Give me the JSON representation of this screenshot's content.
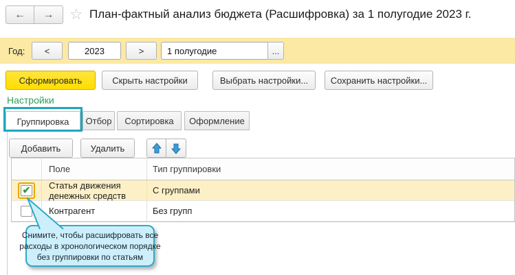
{
  "window": {
    "title": "План-фактный анализ бюджета (Расшифровка) за 1 полугодие 2023 г."
  },
  "icons": {
    "back": "←",
    "forward": "→",
    "favorite": "☆",
    "more": "...",
    "check": "✔",
    "move_up": "up-arrow",
    "move_down": "down-arrow"
  },
  "period_bar": {
    "year_label": "Год:",
    "prev": "<",
    "year": "2023",
    "next": ">",
    "period_value": "1 полугодие"
  },
  "actions": {
    "generate": "Сформировать",
    "hide_settings": "Скрыть настройки",
    "choose_settings": "Выбрать настройки...",
    "save_settings": "Сохранить настройки..."
  },
  "settings": {
    "header": "Настройки",
    "tabs": [
      {
        "label": "Группировка",
        "active": true,
        "highlighted": true
      },
      {
        "label": "Отбор",
        "active": false,
        "highlighted": false
      },
      {
        "label": "Сортировка",
        "active": false,
        "highlighted": false
      },
      {
        "label": "Оформление",
        "active": false,
        "highlighted": false
      }
    ]
  },
  "toolbar": {
    "add": "Добавить",
    "remove": "Удалить"
  },
  "grouping_table": {
    "columns": [
      "",
      "Поле",
      "Тип группировки"
    ],
    "rows": [
      {
        "checked": true,
        "selected": true,
        "field": "Статья движения денежных средств",
        "type": "С группами"
      },
      {
        "checked": false,
        "selected": false,
        "field": "Контрагент",
        "type": "Без групп"
      }
    ]
  },
  "callout": {
    "lines": [
      "Снимите, чтобы расшифровать все",
      "расходы в хронологическом порядке",
      "без группировки по статьям"
    ]
  },
  "colors": {
    "accent_teal": "#1ba6bf",
    "callout_bg": "#cdeffb",
    "period_band": "#fbe9a4",
    "selected_row": "#fdf0c6",
    "generate_button": "#ffdd00",
    "settings_link_green": "#2e9e5c",
    "check_green": "#2f9a3f",
    "focus_ring_gold": "#e8a900",
    "arrow_blue": "#3f9bd5"
  }
}
